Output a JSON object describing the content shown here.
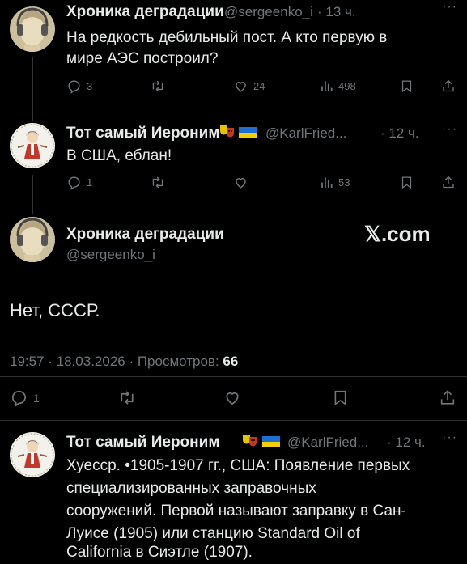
{
  "tweet1": {
    "name": "Хроника деградации",
    "handle": "@sergeenko_i",
    "time": "· 13 ч.",
    "text_line1": "На редкость дебильный пост. А кто первую в",
    "text_line2": "мире АЭС построил?",
    "replies": "3",
    "likes": "24",
    "views": "498"
  },
  "tweet2": {
    "name": "Тот самый Иероним",
    "handle": "@KarlFried...",
    "time": "· 12 ч.",
    "text": "В США, еблан!",
    "replies": "1",
    "views": "53"
  },
  "main": {
    "name": "Хроника деградации",
    "handle": "@sergeenko_i",
    "watermark": "𝕏.com",
    "text": "Нет, СССР.",
    "timestamp": "19:57 · 18.03.2026 · Просмотров:",
    "views_count": "66",
    "replies": "1"
  },
  "tweet3": {
    "name": "Тот самый Иероним",
    "handle": "@KarlFried...",
    "time": "· 12 ч.",
    "lines": [
      "Хуесср. •1905-1907 гг., США: Появление первых",
      "специализированных заправочных",
      "сооружений. Первой называют заправку в Сан-",
      "Луисе (1905) или станцию Standard Oil of",
      "California в Сиэтле (1907)."
    ]
  },
  "colors": {
    "bg": "#000000",
    "text": "#e7e9ea",
    "muted": "#71767b",
    "divider": "#2f3336"
  },
  "icons": [
    "reply-icon",
    "retweet-icon",
    "like-icon",
    "views-icon",
    "bookmark-icon",
    "share-icon",
    "more-icon",
    "theater-masks-icon",
    "ukraine-flag-icon"
  ]
}
